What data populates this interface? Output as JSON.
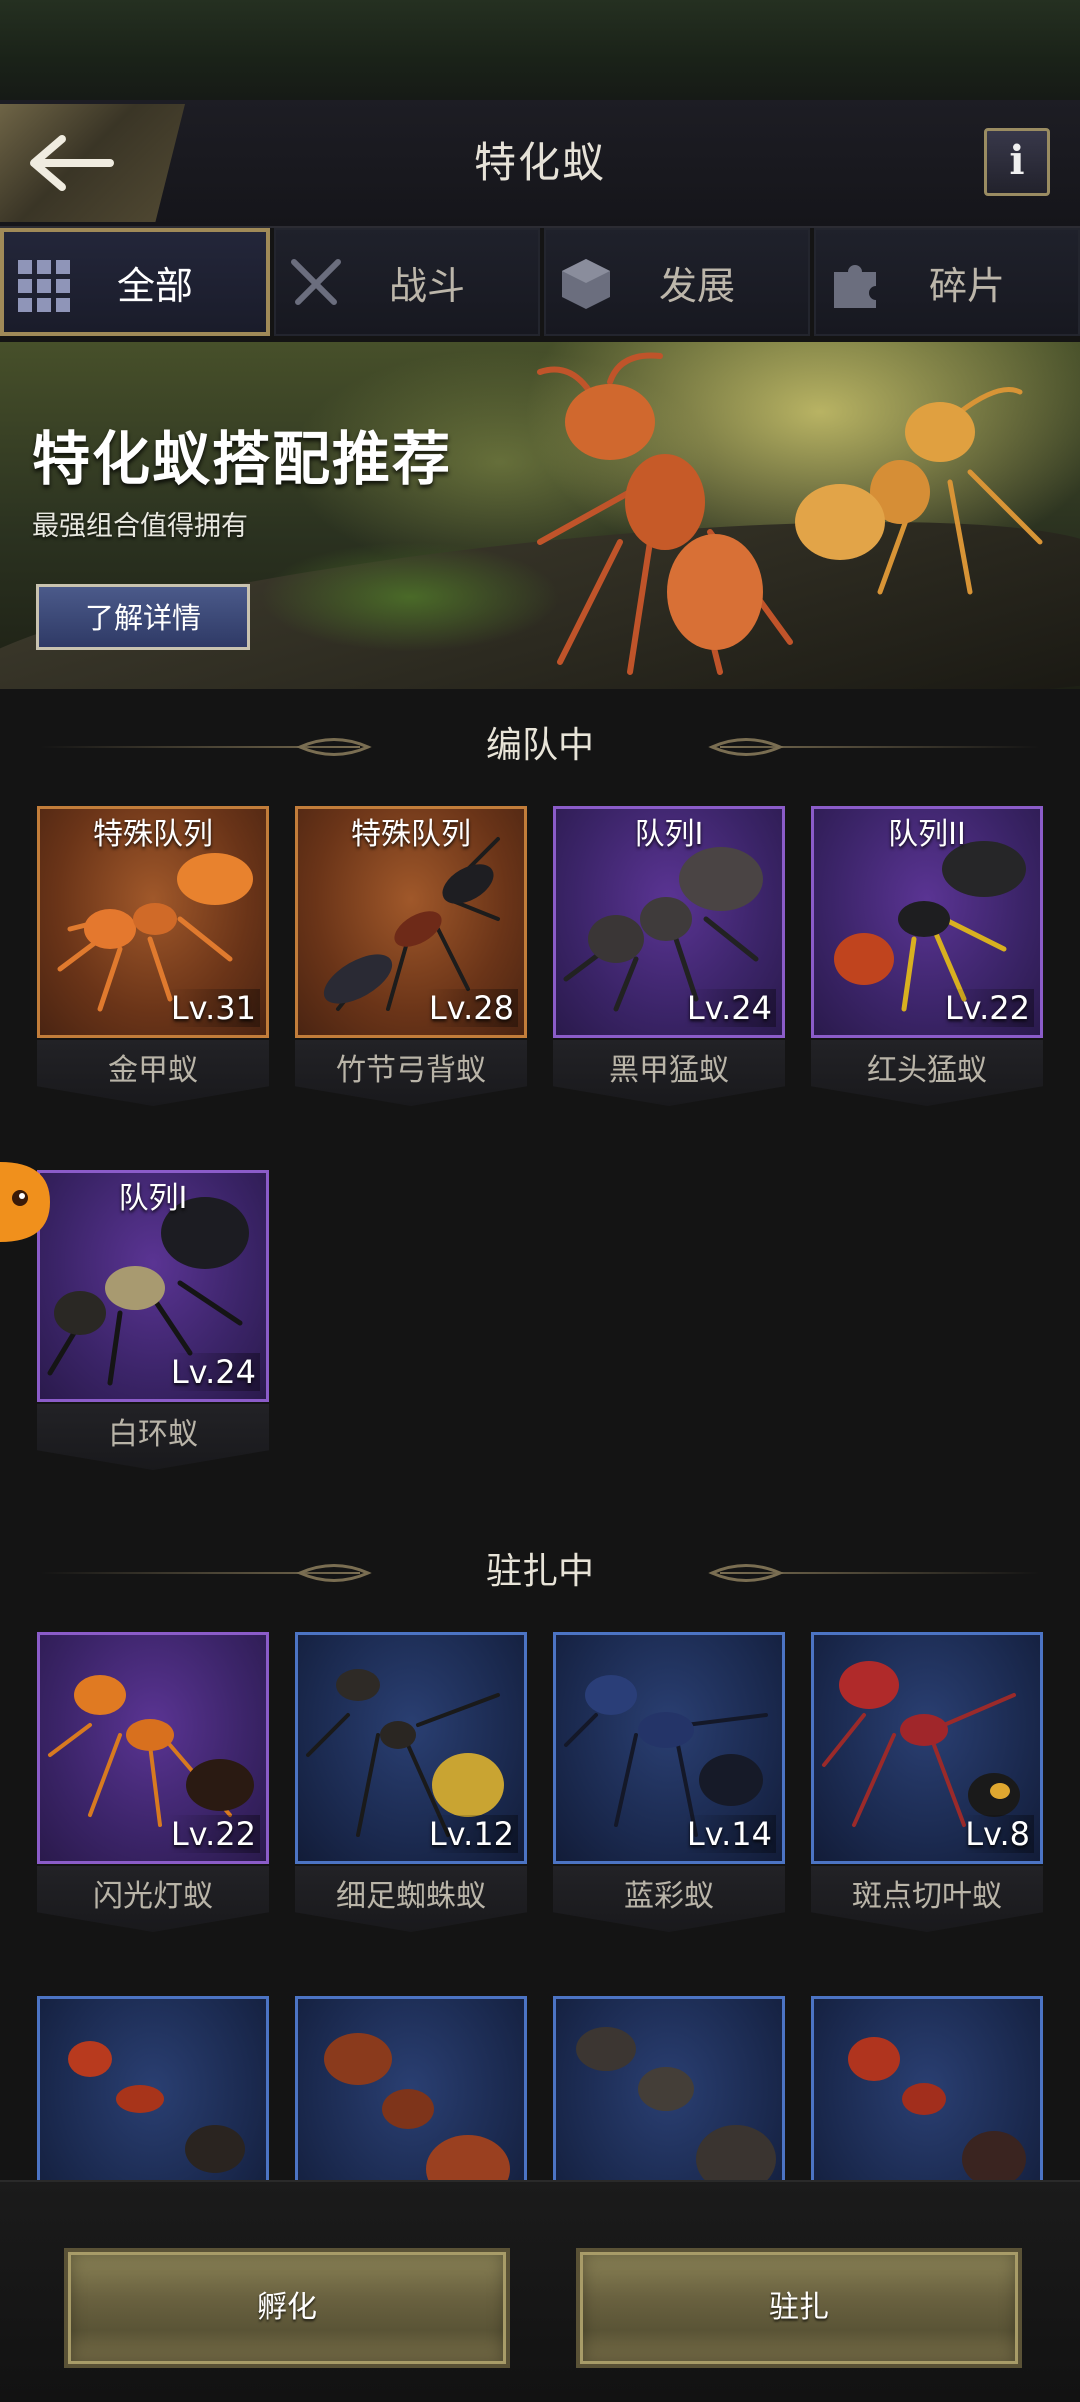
{
  "header": {
    "title": "特化蚁",
    "back_icon": "arrow-left-icon",
    "info_label": "i"
  },
  "tabs": [
    {
      "label": "全部",
      "icon": "grid-icon",
      "active": true
    },
    {
      "label": "战斗",
      "icon": "crossed-swords-icon",
      "active": false
    },
    {
      "label": "发展",
      "icon": "cube-icon",
      "active": false
    },
    {
      "label": "碎片",
      "icon": "puzzle-icon",
      "active": false
    }
  ],
  "banner": {
    "title": "特化蚁搭配推荐",
    "subtitle": "最强组合值得拥有",
    "button_label": "了解详情"
  },
  "sections": {
    "formation": {
      "title": "编队中",
      "cards": [
        {
          "name": "金甲蚁",
          "badge": "特殊队列",
          "level": "Lv.31",
          "rarity": "orange"
        },
        {
          "name": "竹节弓背蚁",
          "badge": "特殊队列",
          "level": "Lv.28",
          "rarity": "orange"
        },
        {
          "name": "黑甲猛蚁",
          "badge": "队列I",
          "level": "Lv.24",
          "rarity": "purple"
        },
        {
          "name": "红头猛蚁",
          "badge": "队列II",
          "level": "Lv.22",
          "rarity": "purple"
        },
        {
          "name": "白环蚁",
          "badge": "队列I",
          "level": "Lv.24",
          "rarity": "purple"
        }
      ]
    },
    "stationed": {
      "title": "驻扎中",
      "cards": [
        {
          "name": "闪光灯蚁",
          "level": "Lv.22",
          "rarity": "purple"
        },
        {
          "name": "细足蜘蛛蚁",
          "level": "Lv.12",
          "rarity": "blue"
        },
        {
          "name": "蓝彩蚁",
          "level": "Lv.14",
          "rarity": "blue"
        },
        {
          "name": "斑点切叶蚁",
          "level": "Lv.8",
          "rarity": "blue"
        }
      ],
      "partial_cards": [
        {
          "rarity": "blue"
        },
        {
          "rarity": "blue"
        },
        {
          "rarity": "blue"
        },
        {
          "rarity": "blue"
        }
      ]
    }
  },
  "actions": {
    "hatch_label": "孵化",
    "station_label": "驻扎"
  },
  "colors": {
    "gold_border": "#a08a58",
    "orange_rarity": "#c27d3a",
    "purple_rarity": "#8b5cc9",
    "blue_rarity": "#4c74c4"
  }
}
